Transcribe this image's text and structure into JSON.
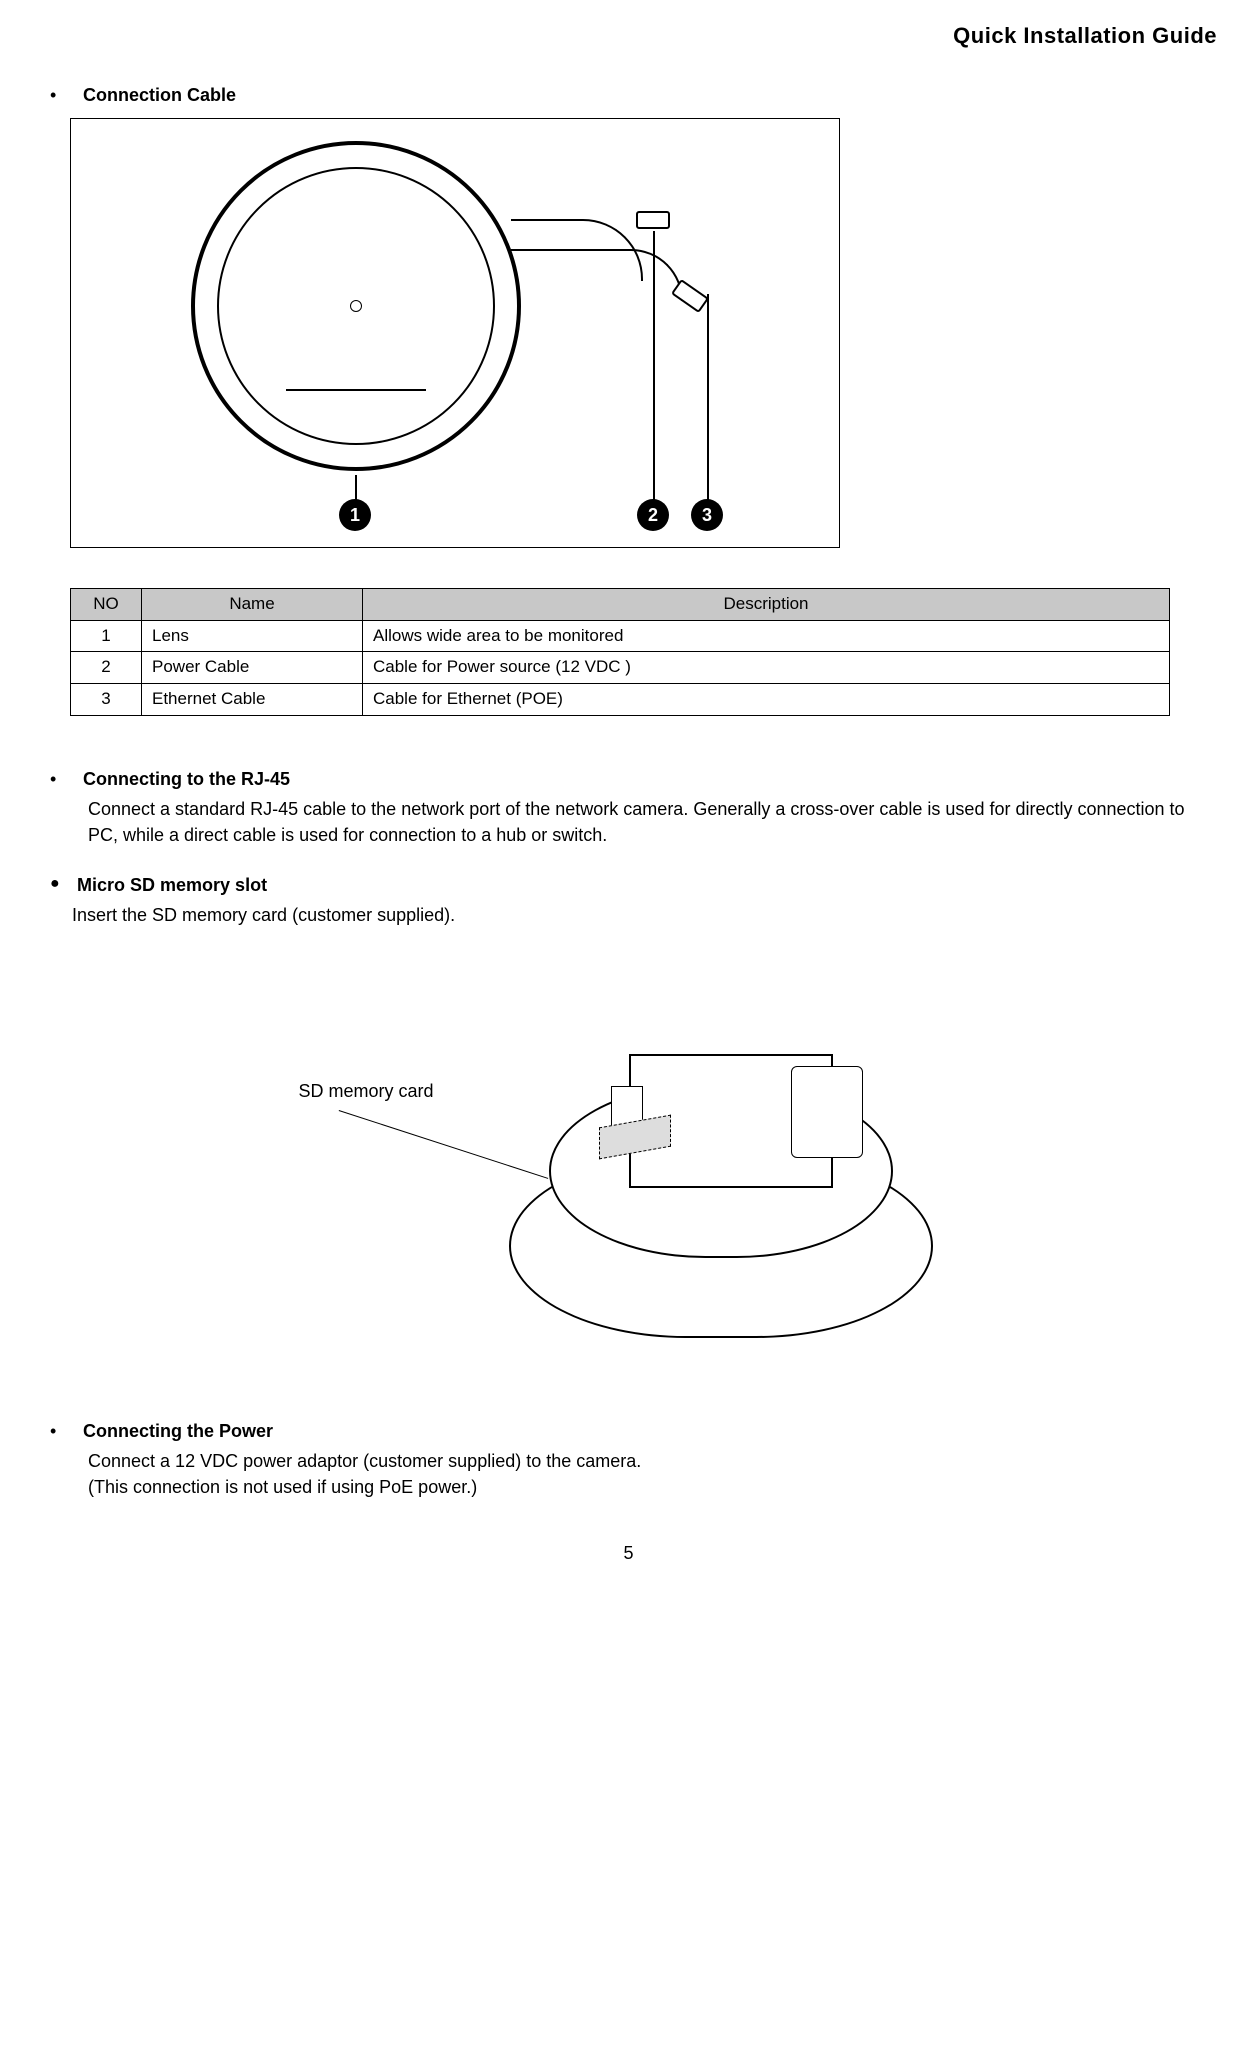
{
  "header": {
    "title": "Quick Installation Guide"
  },
  "sections": {
    "cable": {
      "title": "Connection Cable",
      "markers": {
        "m1": "1",
        "m2": "2",
        "m3": "3"
      }
    },
    "table": {
      "headers": {
        "no": "NO",
        "name": "Name",
        "desc": "Description"
      },
      "rows": [
        {
          "no": "1",
          "name": "Lens",
          "desc": "Allows wide area to be monitored"
        },
        {
          "no": "2",
          "name": "Power Cable",
          "desc": "Cable for Power source (12 VDC )"
        },
        {
          "no": "3",
          "name": "Ethernet Cable",
          "desc": "Cable for Ethernet (POE)"
        }
      ]
    },
    "rj45": {
      "title": "Connecting to the RJ-45",
      "body": "Connect a standard RJ-45 cable to the network port of the network camera. Generally a cross-over cable is used for directly connection to PC, while a direct cable is used for connection to a hub or switch."
    },
    "sd": {
      "title": "Micro SD memory slot",
      "body": "Insert the SD memory card (customer supplied).",
      "callout": "SD memory card"
    },
    "power": {
      "title": "Connecting the Power",
      "body1": "Connect a 12 VDC power adaptor (customer supplied) to the camera.",
      "body2": "(This connection is not used if using PoE power.)"
    }
  },
  "page_number": "5"
}
